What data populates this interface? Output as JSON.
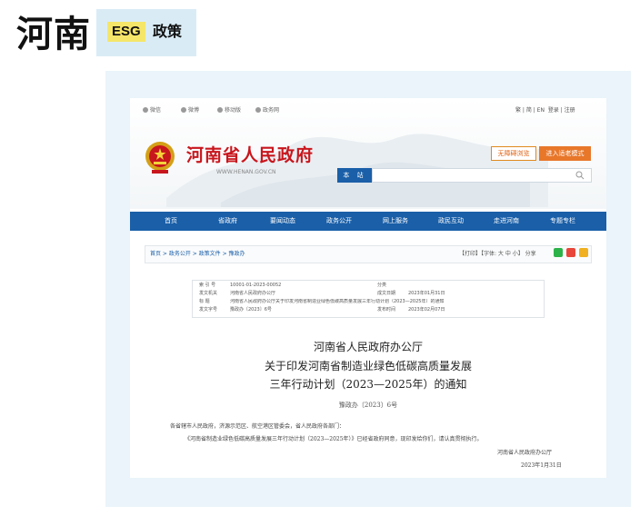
{
  "title": "河南",
  "tag": {
    "badge": "ESG",
    "text": "政策"
  },
  "site": {
    "toolbar": [
      "微信",
      "微博",
      "移动版",
      "政务网"
    ],
    "lang": "繁 | 简 | EN",
    "login": "登录 | 注册",
    "name": "河南省人民政府",
    "url": "WWW.HENAN.GOV.CN",
    "barrier_free": "无障碍浏览",
    "elder_mode": "进入适老模式",
    "search_label": "本 站"
  },
  "nav": [
    "首页",
    "省政府",
    "要闻动态",
    "政务公开",
    "网上服务",
    "政民互动",
    "走进河南",
    "专题专栏"
  ],
  "breadcrumb": "首页 > 政务公开 > 政策文件 > 豫政办",
  "print_tools": "【打印】【字体: 大 中 小】 分享",
  "meta": {
    "index_label": "索 引 号",
    "index_value": "10001-01-2023-00052",
    "issuer_label": "发文机关",
    "issuer_value": "河南省人民政府办公厅",
    "subject_label": "标 题",
    "subject_value": "河南省人民政府办公厅关于印发河南省制造业绿色低碳高质量发展三年行动计划（2023—2025年）的通知",
    "docno_label": "发文字号",
    "docno_value": "豫政办〔2023〕6号",
    "category_label": "分类",
    "category_value": "",
    "date_label": "成文日期",
    "date_value": "2023年01月31日",
    "pub_label": "发布时间",
    "pub_value": "2023年02月07日"
  },
  "article": {
    "issuer": "河南省人民政府办公厅",
    "title_line1": "关于印发河南省制造业绿色低碳高质量发展",
    "title_line2": "三年行动计划（2023—2025年）的通知",
    "doc_number": "豫政办〔2023〕6号",
    "salutation": "各省辖市人民政府，济源示范区、航空港区管委会，省人民政府各部门：",
    "body": "《河南省制造业绿色低碳高质量发展三年行动计划（2023—2025年）》已经省政府同意，现印发给你们，请认真贯彻执行。",
    "signature": "河南省人民政府办公厅",
    "sign_date": "2023年1月31日"
  },
  "colors": {
    "nav": "#1a5fa8",
    "gov_red": "#c8161d",
    "elder": "#e8772a",
    "frame": "#eaf4fa",
    "tag_bg": "#d9ecf6",
    "badge": "#f5e66a"
  }
}
